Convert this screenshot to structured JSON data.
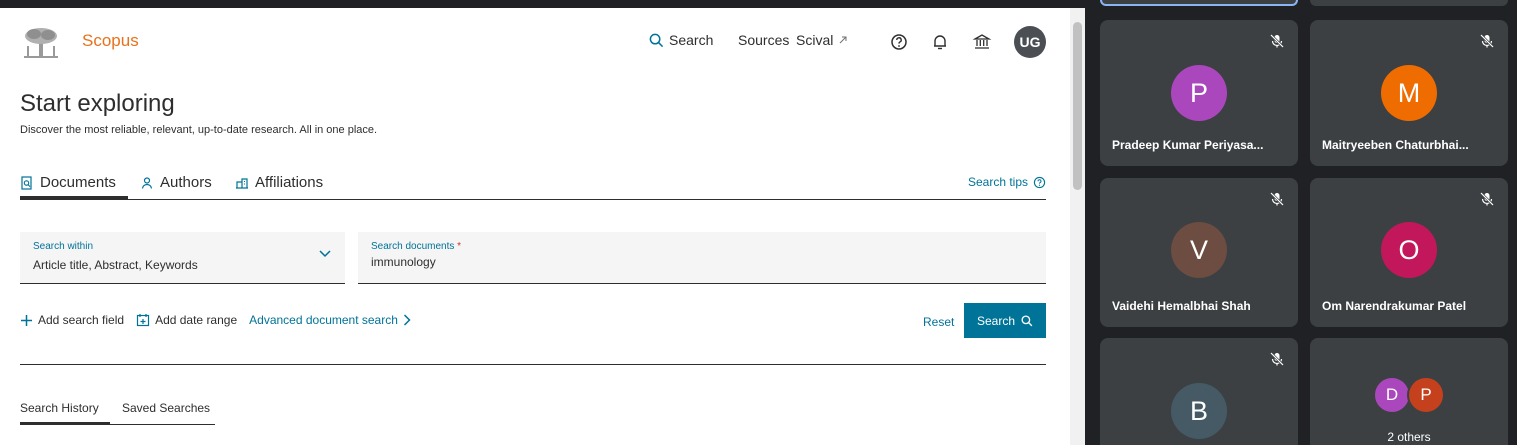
{
  "scopus": {
    "brand": "Scopus",
    "nav": {
      "search": "Search",
      "sources": "Sources",
      "scival": "Scival"
    },
    "user_initials": "UG",
    "page_title": "Start exploring",
    "subtitle": "Discover the most reliable, relevant, up-to-date research. All in one place.",
    "tabs": [
      {
        "label": "Documents",
        "icon": "document-search-icon",
        "active": true
      },
      {
        "label": "Authors",
        "icon": "person-icon",
        "active": false
      },
      {
        "label": "Affiliations",
        "icon": "building-icon",
        "active": false
      }
    ],
    "search_tips": "Search tips",
    "search_within": {
      "label": "Search within",
      "value": "Article title, Abstract, Keywords"
    },
    "search_documents": {
      "label": "Search documents",
      "required_mark": "*",
      "value": "immunology"
    },
    "actions": {
      "add_search_field": "Add search field",
      "add_date_range": "Add date range",
      "advanced_search": "Advanced document search",
      "reset": "Reset",
      "search": "Search"
    },
    "history_tabs": [
      "Search History",
      "Saved Searches"
    ]
  },
  "meet": {
    "participants": [
      {
        "initial": "P",
        "name": "Pradeep Kumar Periyasa...",
        "color": "#ab47bc"
      },
      {
        "initial": "M",
        "name": "Maitryeeben Chaturbhai...",
        "color": "#ef6c00"
      },
      {
        "initial": "V",
        "name": "Vaidehi Hemalbhai Shah",
        "color": "#6d4c41"
      },
      {
        "initial": "O",
        "name": "Om Narendrakumar Patel",
        "color": "#c2185b"
      },
      {
        "initial": "B",
        "name": "",
        "color": "#455a64"
      }
    ],
    "others": {
      "avatars": [
        {
          "initial": "D",
          "color": "#ab47bc"
        },
        {
          "initial": "P",
          "color": "#c5401c"
        }
      ],
      "label": "2 others"
    }
  }
}
